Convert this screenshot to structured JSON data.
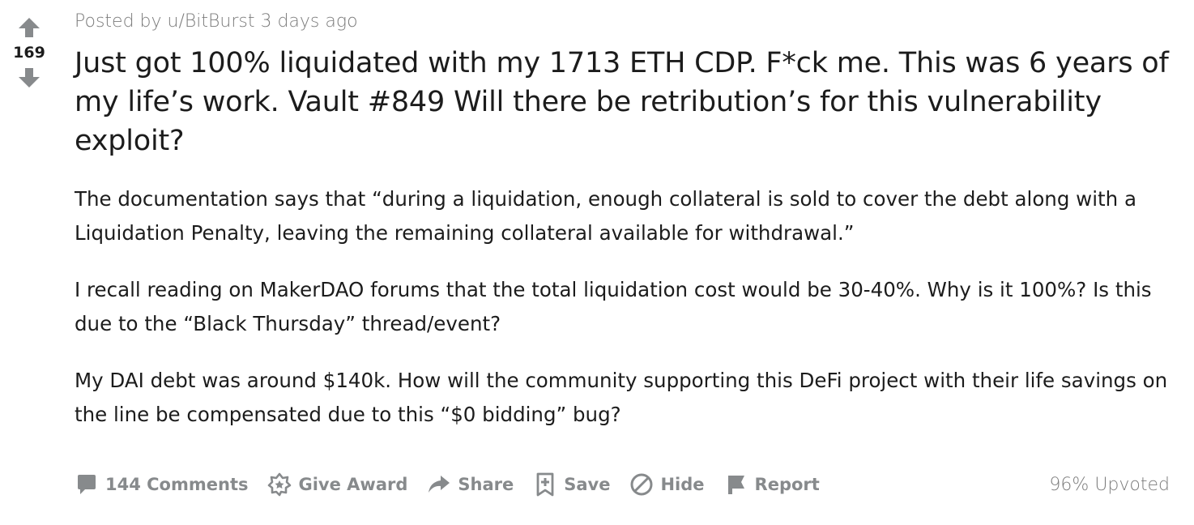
{
  "vote": {
    "score": "169",
    "upvote_icon": "arrow-up-icon",
    "downvote_icon": "arrow-down-icon"
  },
  "post": {
    "meta": "Posted by u/BitBurst 3 days ago",
    "title": "Just got 100% liquidated with my 1713 ETH CDP. F*ck me. This was 6 years of my life’s work. Vault #849 Will there be retribution’s for this vulnerability exploit?",
    "paragraphs": [
      "The documentation says that “during a liquidation, enough collateral is sold to cover the debt along with a Liquidation Penalty, leaving the remaining collateral available for withdrawal.”",
      "I recall reading on MakerDAO forums that the total liquidation cost would be 30-40%. Why is it 100%? Is this due to the “Black Thursday” thread/event?",
      "My DAI debt was around $140k. How will the community supporting this DeFi project with their life savings on the line be compensated due to this “$0 bidding” bug?"
    ]
  },
  "actions": {
    "comments": "144 Comments",
    "award": "Give Award",
    "share": "Share",
    "save": "Save",
    "hide": "Hide",
    "report": "Report",
    "upvoted": "96% Upvoted"
  },
  "colors": {
    "text": "#1c1c1c",
    "meta": "#7c7c7c",
    "action": "#878a8c"
  }
}
